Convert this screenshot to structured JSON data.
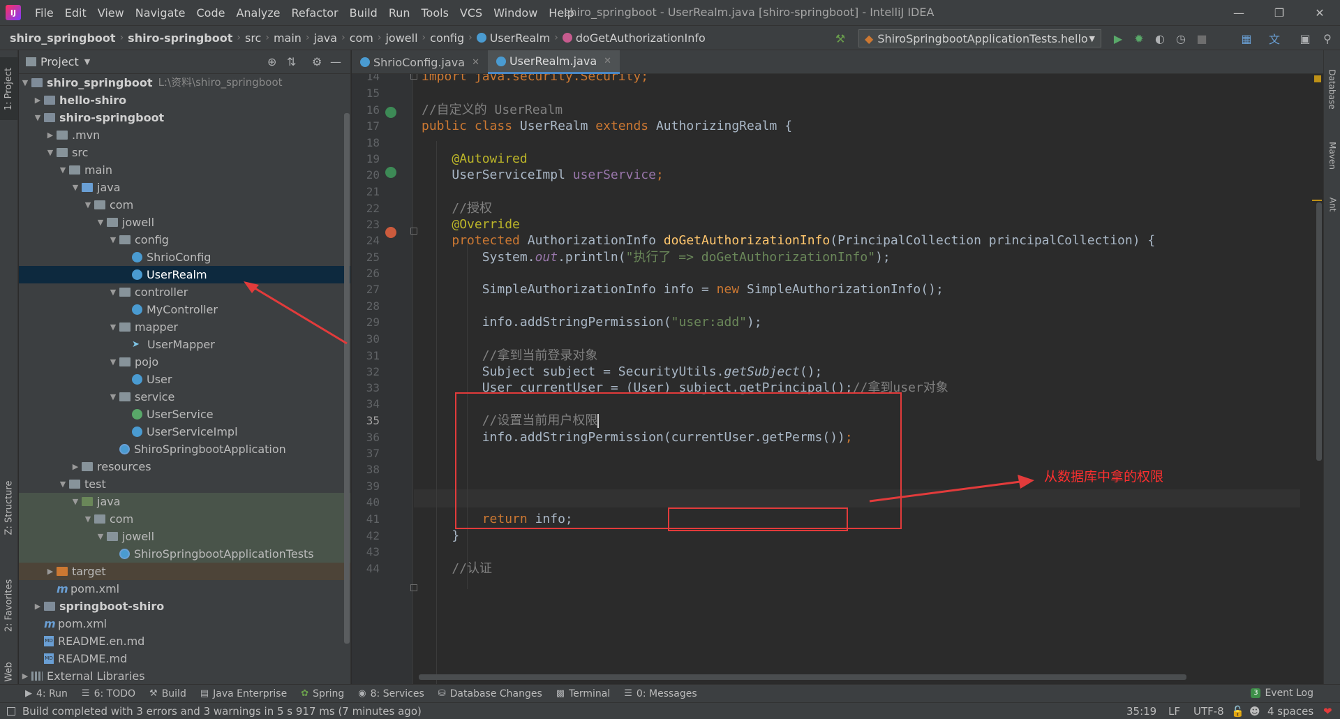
{
  "menu": {
    "items": [
      "File",
      "Edit",
      "View",
      "Navigate",
      "Code",
      "Analyze",
      "Refactor",
      "Build",
      "Run",
      "Tools",
      "VCS",
      "Window",
      "Help"
    ],
    "window_title": "shiro_springboot - UserRealm.java [shiro-springboot] - IntelliJ IDEA"
  },
  "breadcrumb": [
    "shiro_springboot",
    "shiro-springboot",
    "src",
    "main",
    "java",
    "com",
    "jowell",
    "config",
    "UserRealm",
    "doGetAuthorizationInfo"
  ],
  "toolbar": {
    "run_config": "ShiroSpringbootApplicationTests.hello"
  },
  "left_strip": {
    "project": "1: Project",
    "structure": "Z: Structure",
    "favorites": "2: Favorites",
    "web": "Web"
  },
  "right_strip": {
    "database": "Database",
    "maven": "Maven",
    "ant": "Ant"
  },
  "project_panel": {
    "title": "Project",
    "tree": [
      {
        "label": "shiro_springboot",
        "hint": "L:\\资料\\shiro_springboot"
      },
      {
        "label": "hello-shiro"
      },
      {
        "label": "shiro-springboot"
      },
      {
        "label": ".mvn"
      },
      {
        "label": "src"
      },
      {
        "label": "main"
      },
      {
        "label": "java"
      },
      {
        "label": "com"
      },
      {
        "label": "jowell"
      },
      {
        "label": "config"
      },
      {
        "label": "ShrioConfig"
      },
      {
        "label": "UserRealm"
      },
      {
        "label": "controller"
      },
      {
        "label": "MyController"
      },
      {
        "label": "mapper"
      },
      {
        "label": "UserMapper"
      },
      {
        "label": "pojo"
      },
      {
        "label": "User"
      },
      {
        "label": "service"
      },
      {
        "label": "UserService"
      },
      {
        "label": "UserServiceImpl"
      },
      {
        "label": "ShiroSpringbootApplication"
      },
      {
        "label": "resources"
      },
      {
        "label": "test"
      },
      {
        "label": "java"
      },
      {
        "label": "com"
      },
      {
        "label": "jowell"
      },
      {
        "label": "ShiroSpringbootApplicationTests"
      },
      {
        "label": "target"
      },
      {
        "label": "pom.xml"
      },
      {
        "label": "springboot-shiro"
      },
      {
        "label": "pom.xml"
      },
      {
        "label": "README.en.md"
      },
      {
        "label": "README.md"
      },
      {
        "label": "External Libraries"
      }
    ]
  },
  "editor": {
    "tabs": [
      {
        "label": "ShrioConfig.java"
      },
      {
        "label": "UserRealm.java"
      }
    ],
    "line_numbers": [
      "14",
      "15",
      "16",
      "17",
      "18",
      "19",
      "20",
      "21",
      "22",
      "23",
      "24",
      "25",
      "26",
      "27",
      "28",
      "29",
      "30",
      "31",
      "32",
      "33",
      "34",
      "35",
      "36",
      "37",
      "38",
      "39",
      "40",
      "41",
      "42",
      "43",
      "44"
    ],
    "current_line": "35",
    "code": {
      "l14": "import java.security.Security;",
      "l16": "//自定义的 UserRealm",
      "l17_kw1": "public class ",
      "l17_name": "UserRealm ",
      "l17_kw2": "extends ",
      "l17_rest": "AuthorizingRealm {",
      "l19": "@Autowired",
      "l20_type": "UserServiceImpl ",
      "l20_field": "userService",
      "l20_end": ";",
      "l22": "//授权",
      "l23": "@Override",
      "l24_kw": "protected ",
      "l24_type": "AuthorizationInfo ",
      "l24_fn": "doGetAuthorizationInfo",
      "l24_rest": "(PrincipalCollection principalCollection) {",
      "l25_a": "System.",
      "l25_out": "out",
      "l25_b": ".println(",
      "l25_str": "\"执行了 => doGetAuthorizationInfo\"",
      "l25_c": ");",
      "l27_a": "SimpleAuthorizationInfo info = ",
      "l27_kw": "new ",
      "l27_b": "SimpleAuthorizationInfo();",
      "l29_a": "info.addStringPermission(",
      "l29_str": "\"user:add\"",
      "l29_b": ");",
      "l31": "//拿到当前登录对象",
      "l32_a": "Subject subject = SecurityUtils.",
      "l32_it": "getSubject",
      "l32_b": "();",
      "l33_a": "User currentUser = (User) subject.getPrincipal();",
      "l33_cm": "//拿到user对象",
      "l35": "//设置当前用户权限",
      "l36_a": "info.addStringPermission(",
      "l36_b": "currentUser.getPerms())",
      "l36_c": ";",
      "l41_kw": "return ",
      "l41_rest": "info;",
      "l42": "}",
      "l44": "//认证"
    },
    "annotation": "从数据库中拿的权限"
  },
  "bottom_tabs": [
    {
      "label": "4: Run",
      "icon": "run-icon"
    },
    {
      "label": "6: TODO",
      "icon": "todo-icon"
    },
    {
      "label": "Build",
      "icon": "hammer-icon"
    },
    {
      "label": "Java Enterprise",
      "icon": "java-ee-icon"
    },
    {
      "label": "Spring",
      "icon": "spring-icon"
    },
    {
      "label": "8: Services",
      "icon": "services-icon"
    },
    {
      "label": "Database Changes",
      "icon": "database-icon"
    },
    {
      "label": "Terminal",
      "icon": "terminal-icon"
    },
    {
      "label": "0: Messages",
      "icon": "messages-icon"
    }
  ],
  "event_log": {
    "label": "Event Log",
    "count": "3"
  },
  "status": {
    "message": "Build completed with 3 errors and 3 warnings in 5 s 917 ms (7 minutes ago)",
    "position": "35:19",
    "line_sep": "LF",
    "encoding": "UTF-8",
    "indent": "4 spaces"
  }
}
